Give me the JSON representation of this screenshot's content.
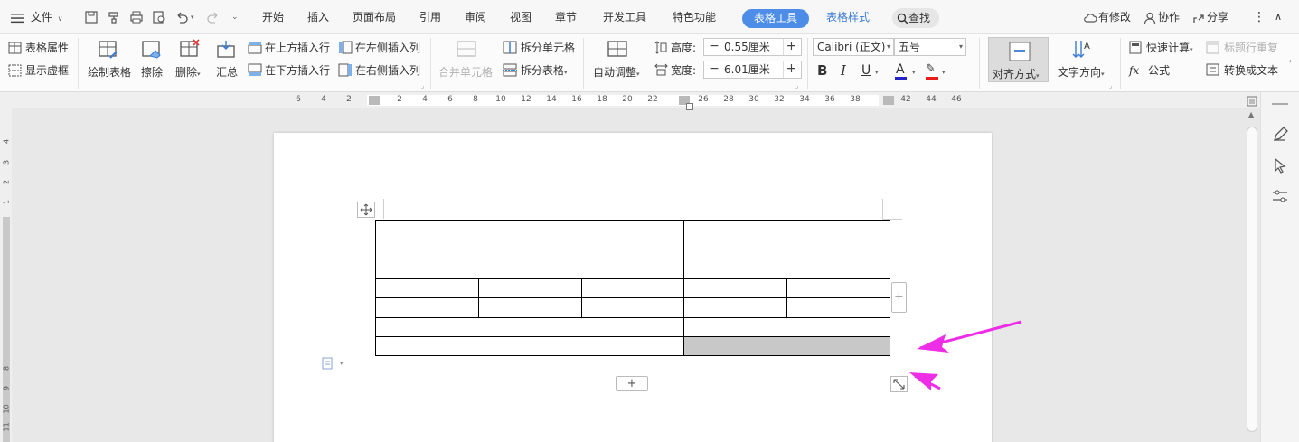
{
  "menu": {
    "file": "文件",
    "tabs": [
      "开始",
      "插入",
      "页面布局",
      "引用",
      "审阅",
      "视图",
      "章节",
      "开发工具",
      "特色功能",
      "表格工具",
      "表格样式"
    ],
    "active_tab": "表格工具",
    "search": "查找",
    "right": {
      "modified": "有修改",
      "collab": "协作",
      "share": "分享"
    }
  },
  "ribbon": {
    "table_props": "表格属性",
    "show_grid": "显示虚框",
    "draw_table": "绘制表格",
    "erase": "擦除",
    "delete": "删除",
    "summary": "汇总",
    "insert_above": "在上方插入行",
    "insert_below": "在下方插入行",
    "insert_left": "在左侧插入列",
    "insert_right": "在右侧插入列",
    "merge_cells": "合并单元格",
    "split_cells": "拆分单元格",
    "split_table": "拆分表格",
    "auto_fit": "自动调整",
    "height_label": "高度:",
    "height_value": "0.55厘米",
    "width_label": "宽度:",
    "width_value": "6.01厘米",
    "font_name": "Calibri (正文)",
    "font_size": "五号",
    "align": "对齐方式",
    "text_dir": "文字方向",
    "quick_calc": "快速计算",
    "repeat_header": "标题行重复",
    "formula": "公式",
    "to_text": "转换成文本"
  },
  "ruler": {
    "h_ticks": [
      "6",
      "4",
      "2",
      "2",
      "4",
      "6",
      "8",
      "10",
      "12",
      "14",
      "16",
      "18",
      "20",
      "22",
      "26",
      "28",
      "30",
      "32",
      "34",
      "36",
      "38",
      "42",
      "44",
      "46"
    ],
    "v_ticks": [
      "4",
      "3",
      "2",
      "1",
      "8",
      "9",
      "10",
      "11"
    ]
  },
  "colors": {
    "accent": "#4d8de8",
    "arrow": "#ee2ee6",
    "shaded_cell": "#c8c8c8",
    "font_color": "#2323c8",
    "highlight": "#e81c1c"
  }
}
